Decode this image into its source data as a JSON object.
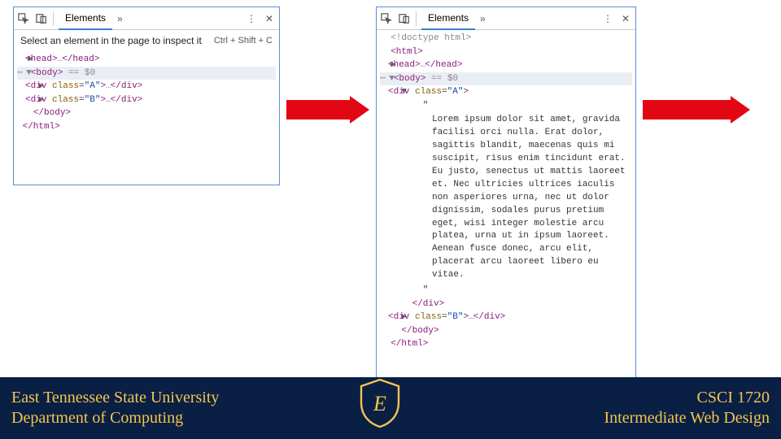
{
  "devtools": {
    "tab_elements": "Elements",
    "chevron": "»",
    "tooltip": "Select an element in the page to inspect it",
    "shortcut": "Ctrl + Shift + C"
  },
  "dom_left": {
    "l1": "  ▶",
    "l1_open": "<head>",
    "l1_dots": "…",
    "l1_close": "</head>",
    "l2_pre": "⋯ ▼",
    "l2_open": "<body>",
    "l2_cursor": " == $0",
    "l3": "    ▶",
    "l3_open": "<div ",
    "l3_attr": "class",
    "l3_eq": "=",
    "l3_str": "\"A\"",
    "l3_close": ">",
    "l3_dots": "…",
    "l3_end": "</div>",
    "l4": "    ▶",
    "l4_open": "<div ",
    "l4_attr": "class",
    "l4_eq": "=",
    "l4_str": "\"B\"",
    "l4_close": ">",
    "l4_dots": "…",
    "l4_end": "</div>",
    "l5": "   ",
    "l5_tag": "</body>",
    "l6": " ",
    "l6_tag": "</html>"
  },
  "dom_right": {
    "r0": "  ",
    "r0_tag": "<!doctype html>",
    "r1": "  ",
    "r1_tag": "<html>",
    "r2": "  ▶",
    "r2_open": "<head>",
    "r2_dots": "…",
    "r2_close": "</head>",
    "r3_pre": "⋯ ▼",
    "r3_open": "<body>",
    "r3_cursor": " == $0",
    "r4": "    ▼",
    "r4_open": "<div ",
    "r4_attr": "class",
    "r4_eq": "=",
    "r4_str": "\"A\"",
    "r4_close": ">",
    "q1": "        \"",
    "lorem": "Lorem ipsum dolor sit amet, gravida facilisi orci nulla. Erat dolor, sagittis blandit, maecenas quis mi suscipit, risus enim tincidunt erat. Eu justo, senectus ut mattis laoreet et. Nec ultricies ultrices iaculis non asperiores urna, nec ut dolor dignissim, sodales purus pretium eget, wisi integer molestie arcu platea, urna ut in ipsum laoreet. Aenean fusce donec, arcu elit, placerat arcu laoreet libero eu vitae.",
    "q2": "        \"",
    "r5": "      ",
    "r5_tag": "</div>",
    "r6": "    ▶",
    "r6_open": "<div ",
    "r6_attr": "class",
    "r6_eq": "=",
    "r6_str": "\"B\"",
    "r6_close": ">",
    "r6_dots": "…",
    "r6_end": "</div>",
    "r7": "    ",
    "r7_tag": "</body>",
    "r8": "  ",
    "r8_tag": "</html>"
  },
  "footer": {
    "line1": "East Tennessee State University",
    "line2": "Department of Computing",
    "course1": "CSCI 1720",
    "course2": "Intermediate Web Design"
  }
}
